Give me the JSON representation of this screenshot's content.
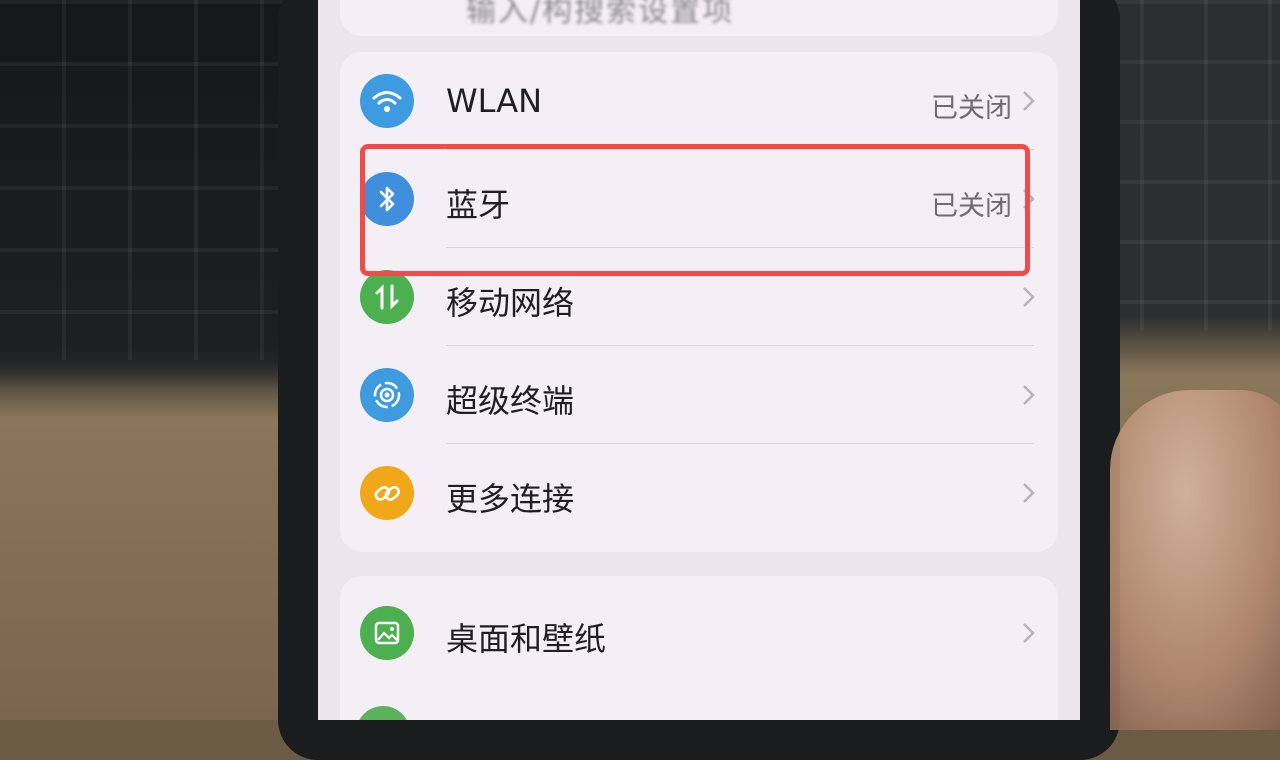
{
  "partial_top_text": "输入/构搜索设置项",
  "connections": [
    {
      "id": "wlan",
      "label": "WLAN",
      "status": "已关闭",
      "icon": "wifi-icon",
      "color": "#3f9be0"
    },
    {
      "id": "bluetooth",
      "label": "蓝牙",
      "status": "已关闭",
      "icon": "bluetooth-icon",
      "color": "#3f8fdc"
    },
    {
      "id": "mobile-network",
      "label": "移动网络",
      "status": "",
      "icon": "mobile-data-icon",
      "color": "#4caf50"
    },
    {
      "id": "super-device",
      "label": "超级终端",
      "status": "",
      "icon": "super-device-icon",
      "color": "#3f9be0"
    },
    {
      "id": "more-connections",
      "label": "更多连接",
      "status": "",
      "icon": "link-icon",
      "color": "#f0a818"
    }
  ],
  "display": [
    {
      "id": "home-wallpaper",
      "label": "桌面和壁纸",
      "status": "",
      "icon": "wallpaper-icon",
      "color": "#4caf50"
    }
  ],
  "highlight_color": "#f04a4a"
}
